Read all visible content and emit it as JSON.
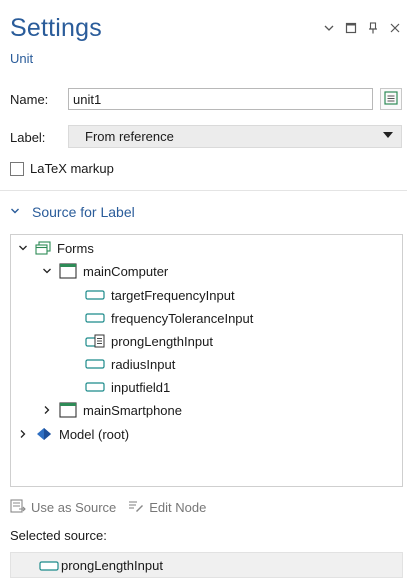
{
  "header": {
    "title": "Settings",
    "subtitle": "Unit"
  },
  "window_controls": [
    "chevron-down-icon",
    "maximize-icon",
    "pin-icon",
    "close-icon"
  ],
  "form": {
    "name_label": "Name:",
    "name_value": "unit1",
    "label_label": "Label:",
    "label_value": "From reference",
    "latex_label": "LaTeX markup",
    "latex_checked": false
  },
  "section": {
    "title": "Source for Label",
    "expanded": true
  },
  "tree": {
    "forms": "Forms",
    "main_computer": "mainComputer",
    "items": {
      "target": "targetFrequencyInput",
      "tolerance": "frequencyToleranceInput",
      "prong": "prongLengthInput",
      "radius": "radiusInput",
      "field1": "inputfield1"
    },
    "main_smartphone": "mainSmartphone",
    "model_root": "Model (root)"
  },
  "actions": {
    "use_as_source": "Use as Source",
    "edit_node": "Edit Node"
  },
  "selected": {
    "label": "Selected source:",
    "value": "prongLengthInput"
  },
  "colors": {
    "accent": "#2a5c9a",
    "folder_green": "#2e8b57",
    "model_blue": "#2f6fc2",
    "input_teal": "#1b8a8a"
  }
}
